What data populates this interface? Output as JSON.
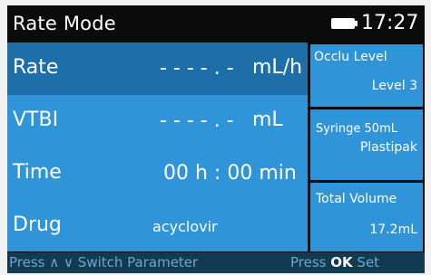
{
  "header": {
    "title": "Rate Mode",
    "time": "17:27"
  },
  "parameters": [
    {
      "label": "Rate",
      "value": "- - - - . -",
      "unit": "mL/h",
      "selected": true
    },
    {
      "label": "VTBI",
      "value": "- - - - . -",
      "unit": "mL"
    },
    {
      "label": "Time",
      "value": "00 h : 00 min",
      "unit": ""
    },
    {
      "label": "Drug",
      "value": "acyclovir",
      "unit": ""
    }
  ],
  "side_panels": [
    {
      "title": "Occlu Level",
      "value": "Level 3"
    },
    {
      "title": "Syringe 50mL",
      "value": "Plastipak"
    },
    {
      "title": "Total Volume",
      "value": "17.2mL"
    }
  ],
  "footer": {
    "press1": "Press",
    "switch_text": "Switch Parameter",
    "press2": "Press",
    "ok_key": "OK",
    "set_text": "Set"
  },
  "colors": {
    "screen_bg": "#0a0a0a",
    "panel_blue": "#2f95d8",
    "selected_blue": "#1e6fa9",
    "footer_bg": "#123a52",
    "footer_text": "#6ea6c9"
  },
  "icons": {
    "battery": "battery-icon",
    "up": "chevron-up-icon",
    "down": "chevron-down-icon"
  }
}
